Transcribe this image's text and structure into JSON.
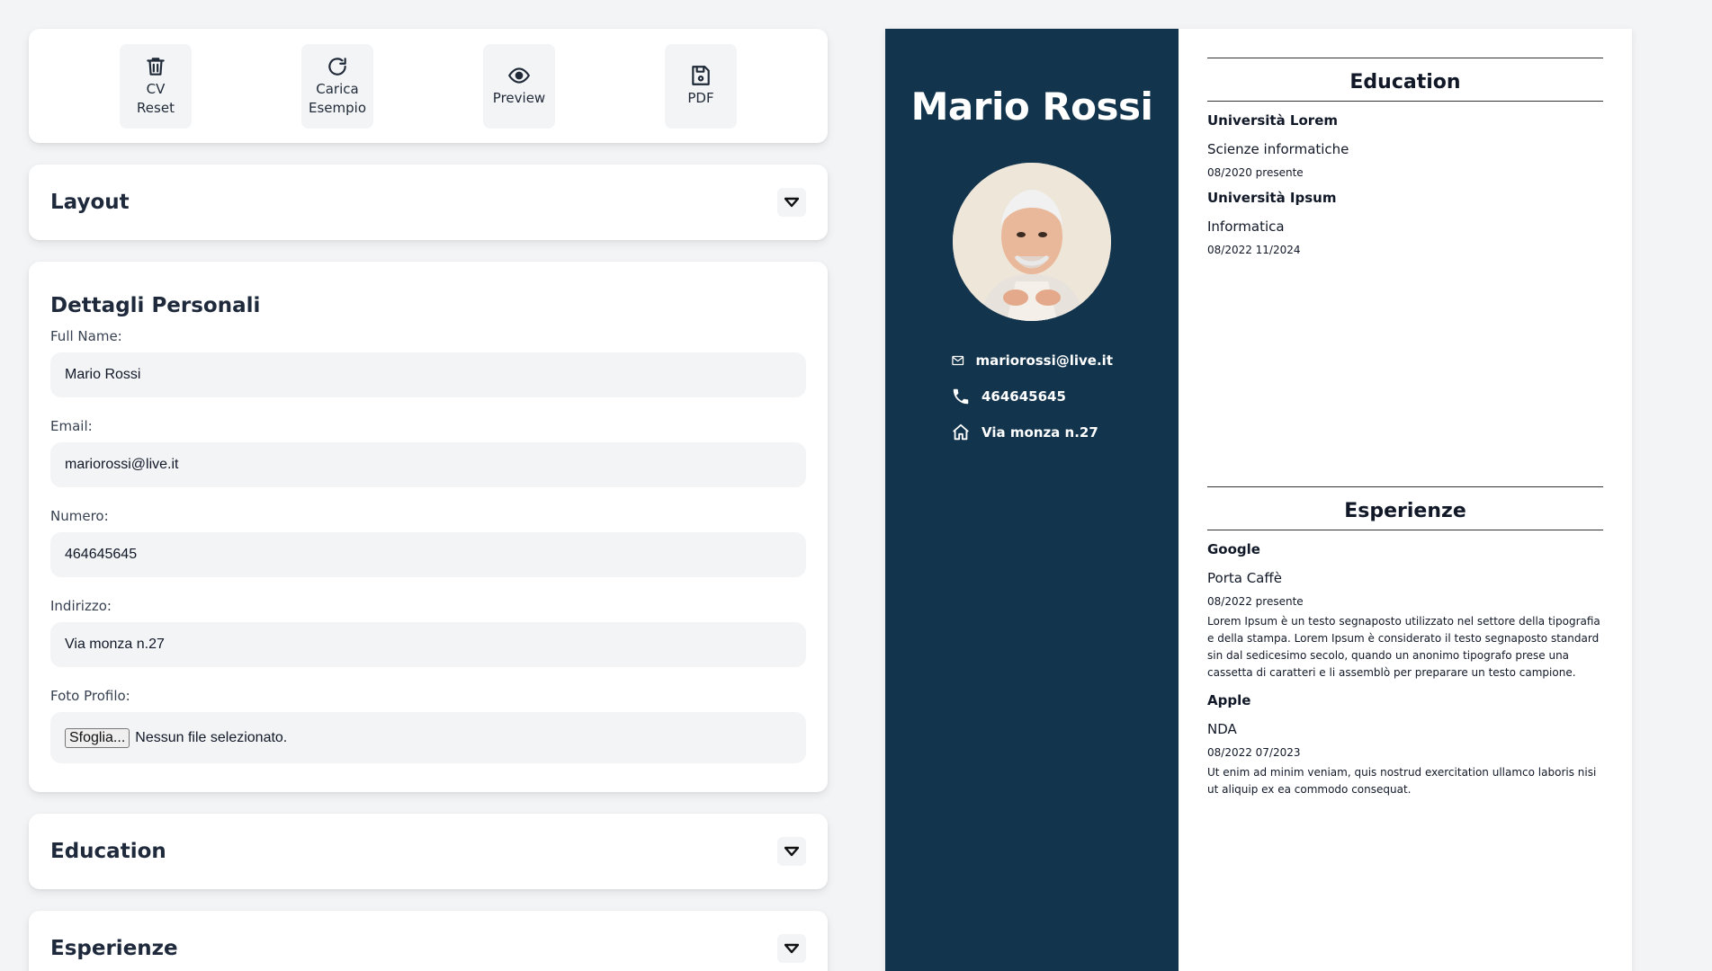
{
  "toolbar": {
    "buttons": [
      {
        "label": "CV\nReset",
        "icon": "trash-icon"
      },
      {
        "label": "Carica\nEsempio",
        "icon": "refresh-icon"
      },
      {
        "label": "Preview",
        "icon": "eye-icon"
      },
      {
        "label": "PDF",
        "icon": "save-icon"
      }
    ]
  },
  "sections": {
    "layout": "Layout",
    "education": "Education",
    "experience": "Esperienze"
  },
  "details": {
    "title": "Dettagli Personali",
    "full_name_label": "Full Name:",
    "full_name_value": "Mario Rossi",
    "email_label": "Email:",
    "email_value": "mariorossi@live.it",
    "number_label": "Numero:",
    "number_value": "464645645",
    "address_label": "Indirizzo:",
    "address_value": "Via monza n.27",
    "photo_label": "Foto Profilo:",
    "file_button": "Sfoglia...",
    "file_status": "Nessun file selezionato."
  },
  "cv": {
    "name": "Mario Rossi",
    "email": "mariorossi@live.it",
    "phone": "464645645",
    "address": "Via monza n.27",
    "education_title": "Education",
    "education": [
      {
        "school": "Università Lorem",
        "course": "Scienze informatiche",
        "dates": "08/2020 presente"
      },
      {
        "school": "Università Ipsum",
        "course": "Informatica",
        "dates": "08/2022 11/2024"
      }
    ],
    "experience_title": "Esperienze",
    "experience": [
      {
        "company": "Google",
        "role": "Porta Caffè",
        "dates": "08/2022 presente",
        "description": "Lorem Ipsum è un testo segnaposto utilizzato nel settore della tipografia e della stampa. Lorem Ipsum è considerato il testo segnaposto standard sin dal sedicesimo secolo, quando un anonimo tipografo prese una cassetta di caratteri e li assemblò per preparare un testo campione."
      },
      {
        "company": "Apple",
        "role": "NDA",
        "dates": "08/2022 07/2023",
        "description": "Ut enim ad minim veniam, quis nostrud exercitation ullamco laboris nisi ut aliquip ex ea commodo consequat."
      }
    ]
  },
  "colors": {
    "sidebar": "#12344d",
    "page_bg": "#f3f4f6"
  }
}
